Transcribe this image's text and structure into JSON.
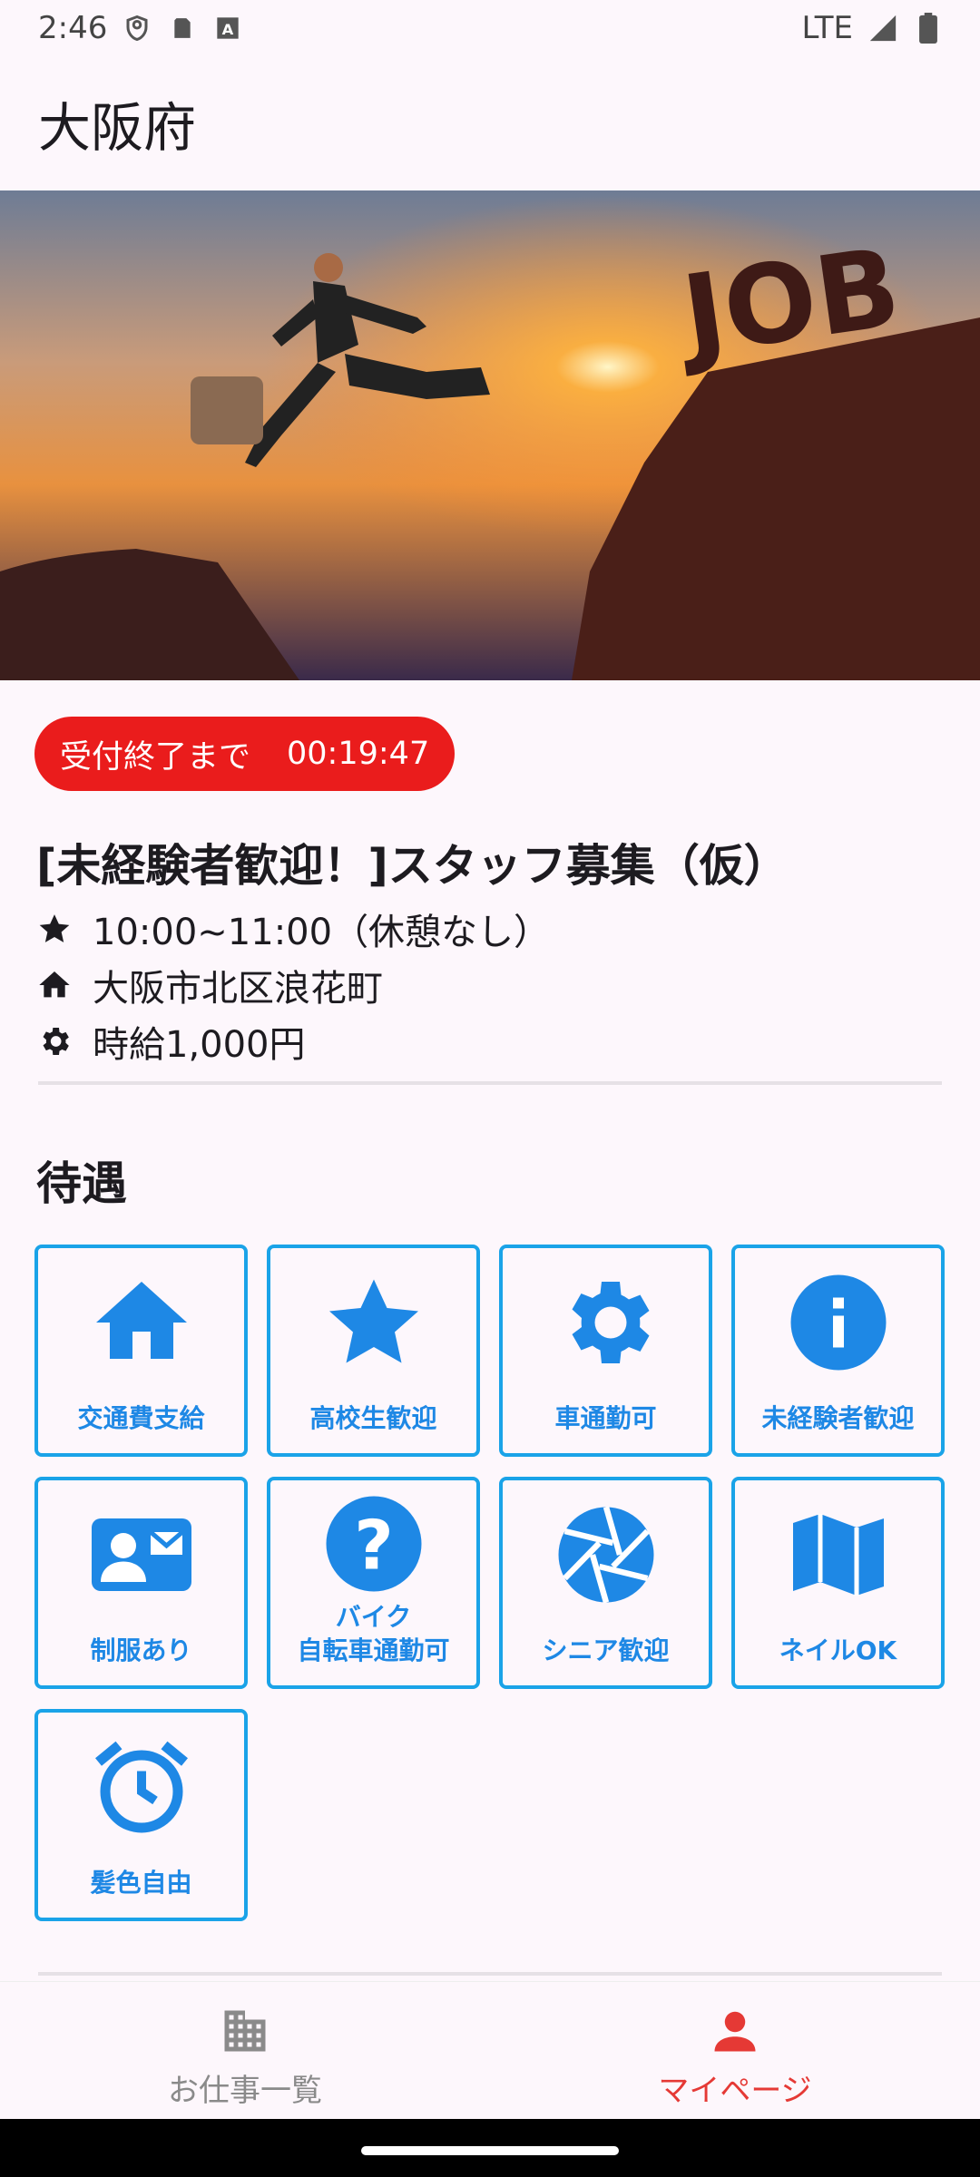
{
  "status_bar": {
    "time": "2:46",
    "network": "LTE"
  },
  "app_bar": {
    "title": "大阪府"
  },
  "countdown": {
    "label": "受付終了まで",
    "time": "00:19:47"
  },
  "job": {
    "title": "[未経験者歓迎！]スタッフ募集（仮）",
    "hours": "10:00~11:00（休憩なし）",
    "location": "大阪市北区浪花町",
    "wage": "時給1,000円"
  },
  "benefits": {
    "title": "待遇",
    "items": [
      {
        "label": "交通費支給",
        "icon": "home-icon"
      },
      {
        "label": "高校生歓迎",
        "icon": "star-icon"
      },
      {
        "label": "車通勤可",
        "icon": "gear-icon"
      },
      {
        "label": "未経験者歓迎",
        "icon": "info-icon"
      },
      {
        "label": "制服あり",
        "icon": "contact-card-icon"
      },
      {
        "label": "バイク\n自転車通勤可",
        "icon": "help-icon"
      },
      {
        "label": "シニア歓迎",
        "icon": "camera-shutter-icon"
      },
      {
        "label": "ネイルOK",
        "icon": "map-icon"
      },
      {
        "label": "髪色自由",
        "icon": "alarm-icon"
      }
    ]
  },
  "hero": {
    "overlay_text": "JOB"
  },
  "nav": {
    "items": [
      {
        "label": "お仕事一覧",
        "icon": "building-icon",
        "active": false
      },
      {
        "label": "マイページ",
        "icon": "person-icon",
        "active": true
      }
    ]
  },
  "colors": {
    "accent": "#1e88e5",
    "tile_border": "#1aa3e8",
    "badge": "#ea1c1c",
    "nav_active": "#e53935",
    "nav_inactive": "#8a8a8a"
  }
}
